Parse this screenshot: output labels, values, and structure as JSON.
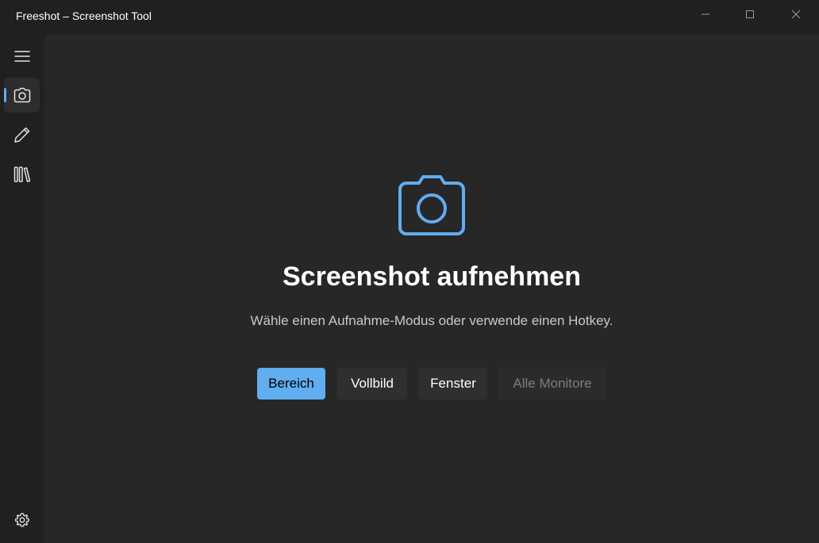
{
  "window": {
    "title": "Freeshot – Screenshot Tool"
  },
  "colors": {
    "accent": "#60adf0",
    "background": "#202020",
    "content": "#272727",
    "button": "#2f2f2f",
    "disabled_text": "#7d7d7d"
  },
  "sidebar": {
    "items": [
      {
        "icon": "hamburger-menu-icon"
      },
      {
        "icon": "camera-icon",
        "active": true
      },
      {
        "icon": "pencil-icon"
      },
      {
        "icon": "library-icon"
      }
    ],
    "footer": {
      "icon": "gear-icon"
    }
  },
  "main": {
    "icon": "camera-icon",
    "title": "Screenshot aufnehmen",
    "subtitle": "Wähle einen Aufnahme-Modus oder verwende einen Hotkey.",
    "buttons": [
      {
        "label": "Bereich",
        "state": "primary"
      },
      {
        "label": "Vollbild",
        "state": "normal"
      },
      {
        "label": "Fenster",
        "state": "normal"
      },
      {
        "label": "Alle Monitore",
        "state": "disabled"
      }
    ]
  }
}
